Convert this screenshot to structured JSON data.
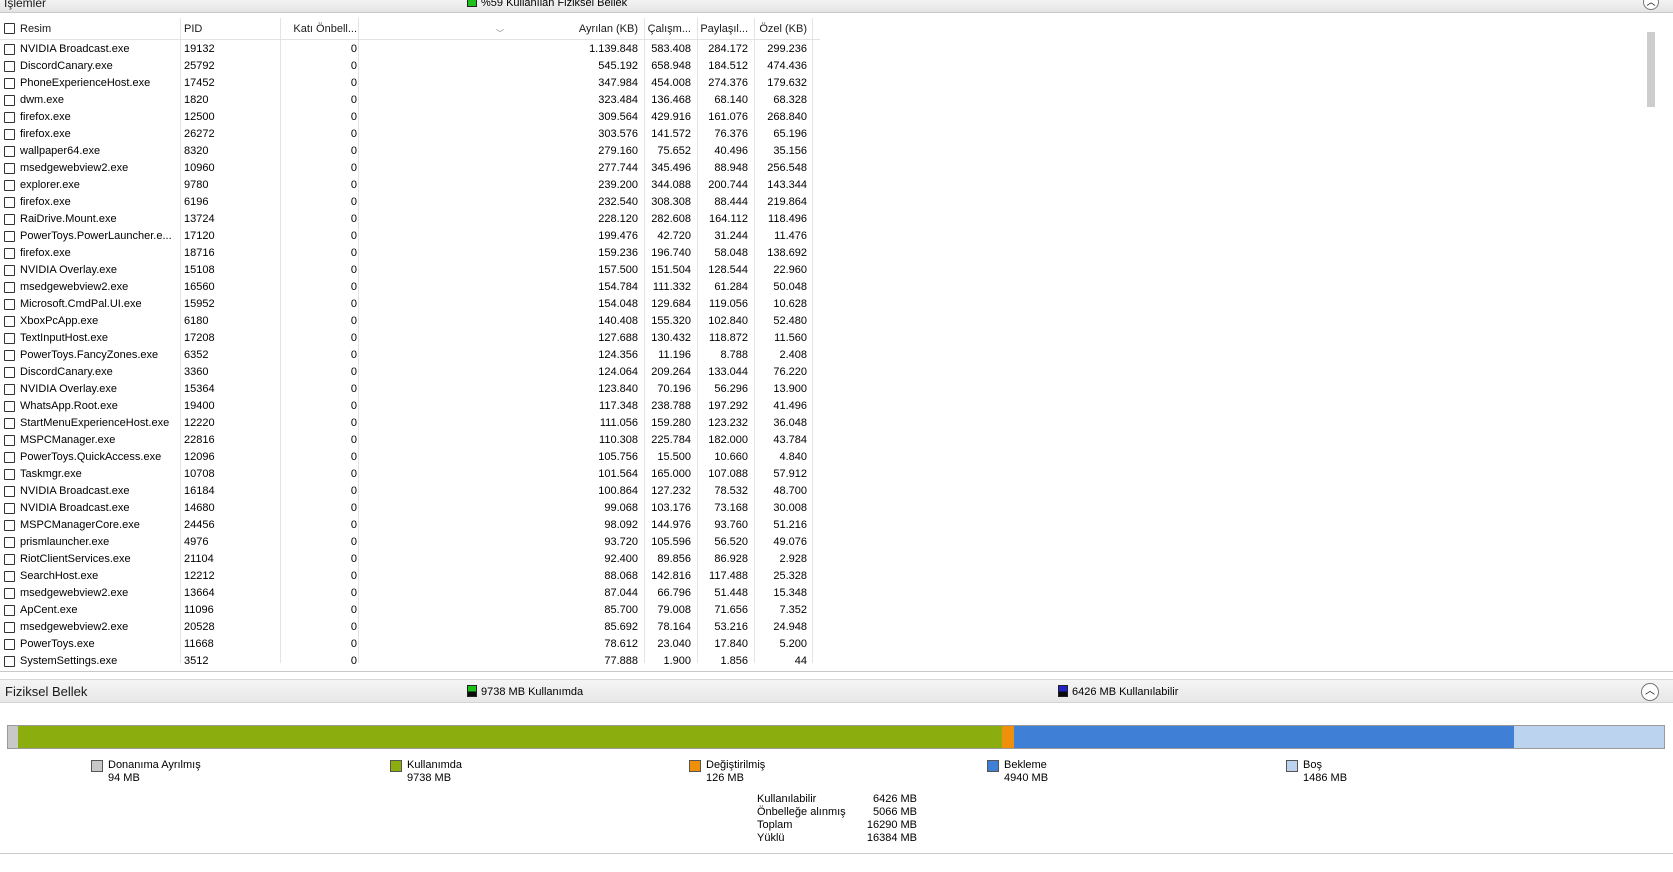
{
  "processes_section": {
    "title": "İşlemler",
    "legend_text": "%59 Kullanılan Fiziksel Bellek",
    "legend_color": "#1ec01e"
  },
  "table": {
    "columns": {
      "image": "Resim",
      "pid": "PID",
      "hard_faults": "Katı Önbell...",
      "commit": "Ayrılan (KB)",
      "working_set": "Çalışm...",
      "shareable": "Paylaşıl...",
      "private": "Özel (KB)"
    },
    "rows": [
      {
        "image": "NVIDIA Broadcast.exe",
        "pid": "19132",
        "hard": "0",
        "commit": "1.139.848",
        "ws": "583.408",
        "share": "284.172",
        "priv": "299.236"
      },
      {
        "image": "DiscordCanary.exe",
        "pid": "25792",
        "hard": "0",
        "commit": "545.192",
        "ws": "658.948",
        "share": "184.512",
        "priv": "474.436"
      },
      {
        "image": "PhoneExperienceHost.exe",
        "pid": "17452",
        "hard": "0",
        "commit": "347.984",
        "ws": "454.008",
        "share": "274.376",
        "priv": "179.632"
      },
      {
        "image": "dwm.exe",
        "pid": "1820",
        "hard": "0",
        "commit": "323.484",
        "ws": "136.468",
        "share": "68.140",
        "priv": "68.328"
      },
      {
        "image": "firefox.exe",
        "pid": "12500",
        "hard": "0",
        "commit": "309.564",
        "ws": "429.916",
        "share": "161.076",
        "priv": "268.840"
      },
      {
        "image": "firefox.exe",
        "pid": "26272",
        "hard": "0",
        "commit": "303.576",
        "ws": "141.572",
        "share": "76.376",
        "priv": "65.196"
      },
      {
        "image": "wallpaper64.exe",
        "pid": "8320",
        "hard": "0",
        "commit": "279.160",
        "ws": "75.652",
        "share": "40.496",
        "priv": "35.156"
      },
      {
        "image": "msedgewebview2.exe",
        "pid": "10960",
        "hard": "0",
        "commit": "277.744",
        "ws": "345.496",
        "share": "88.948",
        "priv": "256.548"
      },
      {
        "image": "explorer.exe",
        "pid": "9780",
        "hard": "0",
        "commit": "239.200",
        "ws": "344.088",
        "share": "200.744",
        "priv": "143.344"
      },
      {
        "image": "firefox.exe",
        "pid": "6196",
        "hard": "0",
        "commit": "232.540",
        "ws": "308.308",
        "share": "88.444",
        "priv": "219.864"
      },
      {
        "image": "RaiDrive.Mount.exe",
        "pid": "13724",
        "hard": "0",
        "commit": "228.120",
        "ws": "282.608",
        "share": "164.112",
        "priv": "118.496"
      },
      {
        "image": "PowerToys.PowerLauncher.e...",
        "pid": "17120",
        "hard": "0",
        "commit": "199.476",
        "ws": "42.720",
        "share": "31.244",
        "priv": "11.476"
      },
      {
        "image": "firefox.exe",
        "pid": "18716",
        "hard": "0",
        "commit": "159.236",
        "ws": "196.740",
        "share": "58.048",
        "priv": "138.692"
      },
      {
        "image": "NVIDIA Overlay.exe",
        "pid": "15108",
        "hard": "0",
        "commit": "157.500",
        "ws": "151.504",
        "share": "128.544",
        "priv": "22.960"
      },
      {
        "image": "msedgewebview2.exe",
        "pid": "16560",
        "hard": "0",
        "commit": "154.784",
        "ws": "111.332",
        "share": "61.284",
        "priv": "50.048"
      },
      {
        "image": "Microsoft.CmdPal.UI.exe",
        "pid": "15952",
        "hard": "0",
        "commit": "154.048",
        "ws": "129.684",
        "share": "119.056",
        "priv": "10.628"
      },
      {
        "image": "XboxPcApp.exe",
        "pid": "6180",
        "hard": "0",
        "commit": "140.408",
        "ws": "155.320",
        "share": "102.840",
        "priv": "52.480"
      },
      {
        "image": "TextInputHost.exe",
        "pid": "17208",
        "hard": "0",
        "commit": "127.688",
        "ws": "130.432",
        "share": "118.872",
        "priv": "11.560"
      },
      {
        "image": "PowerToys.FancyZones.exe",
        "pid": "6352",
        "hard": "0",
        "commit": "124.356",
        "ws": "11.196",
        "share": "8.788",
        "priv": "2.408"
      },
      {
        "image": "DiscordCanary.exe",
        "pid": "3360",
        "hard": "0",
        "commit": "124.064",
        "ws": "209.264",
        "share": "133.044",
        "priv": "76.220"
      },
      {
        "image": "NVIDIA Overlay.exe",
        "pid": "15364",
        "hard": "0",
        "commit": "123.840",
        "ws": "70.196",
        "share": "56.296",
        "priv": "13.900"
      },
      {
        "image": "WhatsApp.Root.exe",
        "pid": "19400",
        "hard": "0",
        "commit": "117.348",
        "ws": "238.788",
        "share": "197.292",
        "priv": "41.496"
      },
      {
        "image": "StartMenuExperienceHost.exe",
        "pid": "12220",
        "hard": "0",
        "commit": "111.056",
        "ws": "159.280",
        "share": "123.232",
        "priv": "36.048"
      },
      {
        "image": "MSPCManager.exe",
        "pid": "22816",
        "hard": "0",
        "commit": "110.308",
        "ws": "225.784",
        "share": "182.000",
        "priv": "43.784"
      },
      {
        "image": "PowerToys.QuickAccess.exe",
        "pid": "12096",
        "hard": "0",
        "commit": "105.756",
        "ws": "15.500",
        "share": "10.660",
        "priv": "4.840"
      },
      {
        "image": "Taskmgr.exe",
        "pid": "10708",
        "hard": "0",
        "commit": "101.564",
        "ws": "165.000",
        "share": "107.088",
        "priv": "57.912"
      },
      {
        "image": "NVIDIA Broadcast.exe",
        "pid": "16184",
        "hard": "0",
        "commit": "100.864",
        "ws": "127.232",
        "share": "78.532",
        "priv": "48.700"
      },
      {
        "image": "NVIDIA Broadcast.exe",
        "pid": "14680",
        "hard": "0",
        "commit": "99.068",
        "ws": "103.176",
        "share": "73.168",
        "priv": "30.008"
      },
      {
        "image": "MSPCManagerCore.exe",
        "pid": "24456",
        "hard": "0",
        "commit": "98.092",
        "ws": "144.976",
        "share": "93.760",
        "priv": "51.216"
      },
      {
        "image": "prismlauncher.exe",
        "pid": "4976",
        "hard": "0",
        "commit": "93.720",
        "ws": "105.596",
        "share": "56.520",
        "priv": "49.076"
      },
      {
        "image": "RiotClientServices.exe",
        "pid": "21104",
        "hard": "0",
        "commit": "92.400",
        "ws": "89.856",
        "share": "86.928",
        "priv": "2.928"
      },
      {
        "image": "SearchHost.exe",
        "pid": "12212",
        "hard": "0",
        "commit": "88.068",
        "ws": "142.816",
        "share": "117.488",
        "priv": "25.328"
      },
      {
        "image": "msedgewebview2.exe",
        "pid": "13664",
        "hard": "0",
        "commit": "87.044",
        "ws": "66.796",
        "share": "51.448",
        "priv": "15.348"
      },
      {
        "image": "ApCent.exe",
        "pid": "11096",
        "hard": "0",
        "commit": "85.700",
        "ws": "79.008",
        "share": "71.656",
        "priv": "7.352"
      },
      {
        "image": "msedgewebview2.exe",
        "pid": "20528",
        "hard": "0",
        "commit": "85.692",
        "ws": "78.164",
        "share": "53.216",
        "priv": "24.948"
      },
      {
        "image": "PowerToys.exe",
        "pid": "11668",
        "hard": "0",
        "commit": "78.612",
        "ws": "23.040",
        "share": "17.840",
        "priv": "5.200"
      },
      {
        "image": "SystemSettings.exe",
        "pid": "3512",
        "hard": "0",
        "commit": "77.888",
        "ws": "1.900",
        "share": "1.856",
        "priv": "44"
      }
    ]
  },
  "memory_section": {
    "title": "Fiziksel Bellek",
    "in_use_legend": "9738 MB Kullanımda",
    "available_legend": "6426 MB Kullanılabilir",
    "bar_segments_mb": {
      "hardware_reserved": 94,
      "in_use": 9738,
      "modified": 126,
      "standby": 4940,
      "free": 1486
    },
    "legend": [
      {
        "name": "Donanıma Ayrılmış",
        "value": "94 MB",
        "color": "#c8c8c8"
      },
      {
        "name": "Kullanımda",
        "value": "9738 MB",
        "color": "#8bad0e"
      },
      {
        "name": "Değiştirilmiş",
        "value": "126 MB",
        "color": "#f0900a"
      },
      {
        "name": "Bekleme",
        "value": "4940 MB",
        "color": "#3f7fd6"
      },
      {
        "name": "Boş",
        "value": "1486 MB",
        "color": "#bcd3ef"
      }
    ],
    "summary": [
      {
        "label": "Kullanılabilir",
        "value": "6426 MB"
      },
      {
        "label": "Önbelleğe alınmış",
        "value": "5066 MB"
      },
      {
        "label": "Toplam",
        "value": "16290 MB"
      },
      {
        "label": "Yüklü",
        "value": "16384 MB"
      }
    ]
  }
}
